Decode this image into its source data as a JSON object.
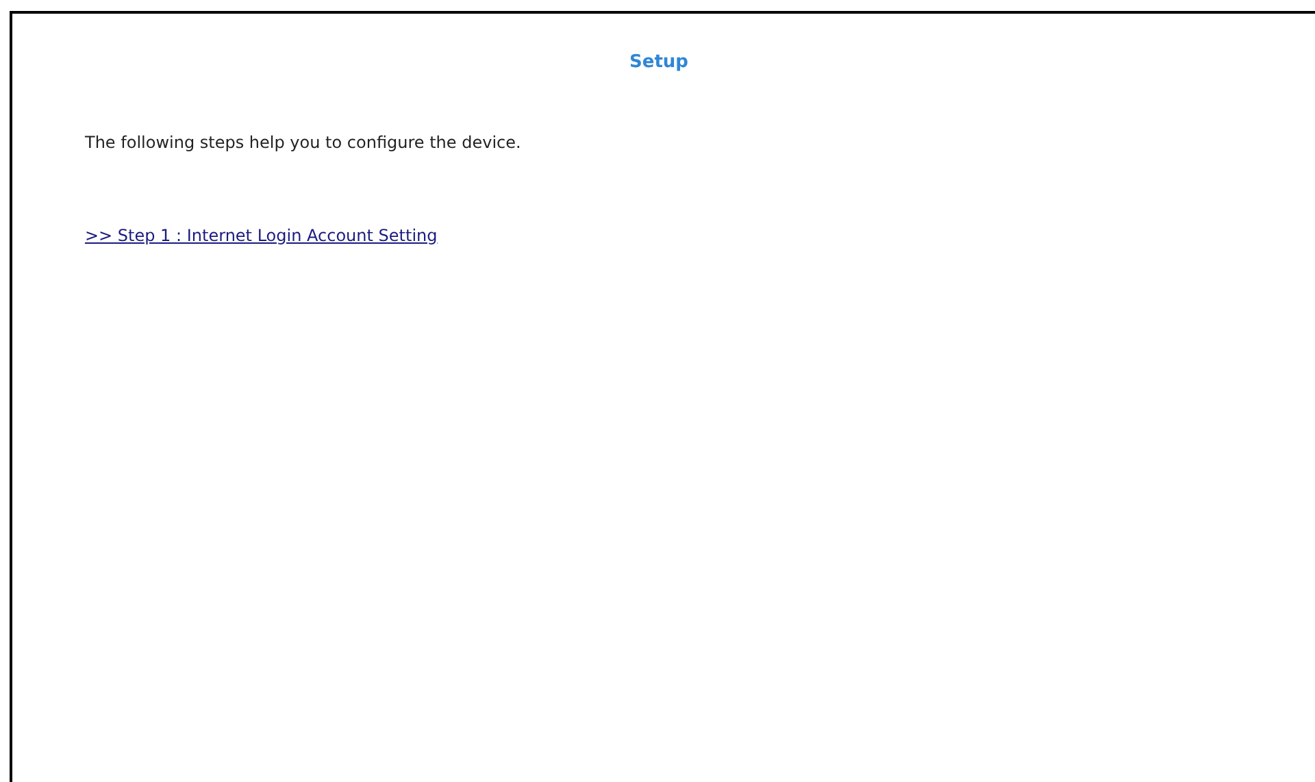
{
  "title": "Setup",
  "intro": "The following steps help you to configure the device.",
  "steps": [
    {
      "label": ">> Step 1 : Internet Login Account Setting"
    }
  ]
}
